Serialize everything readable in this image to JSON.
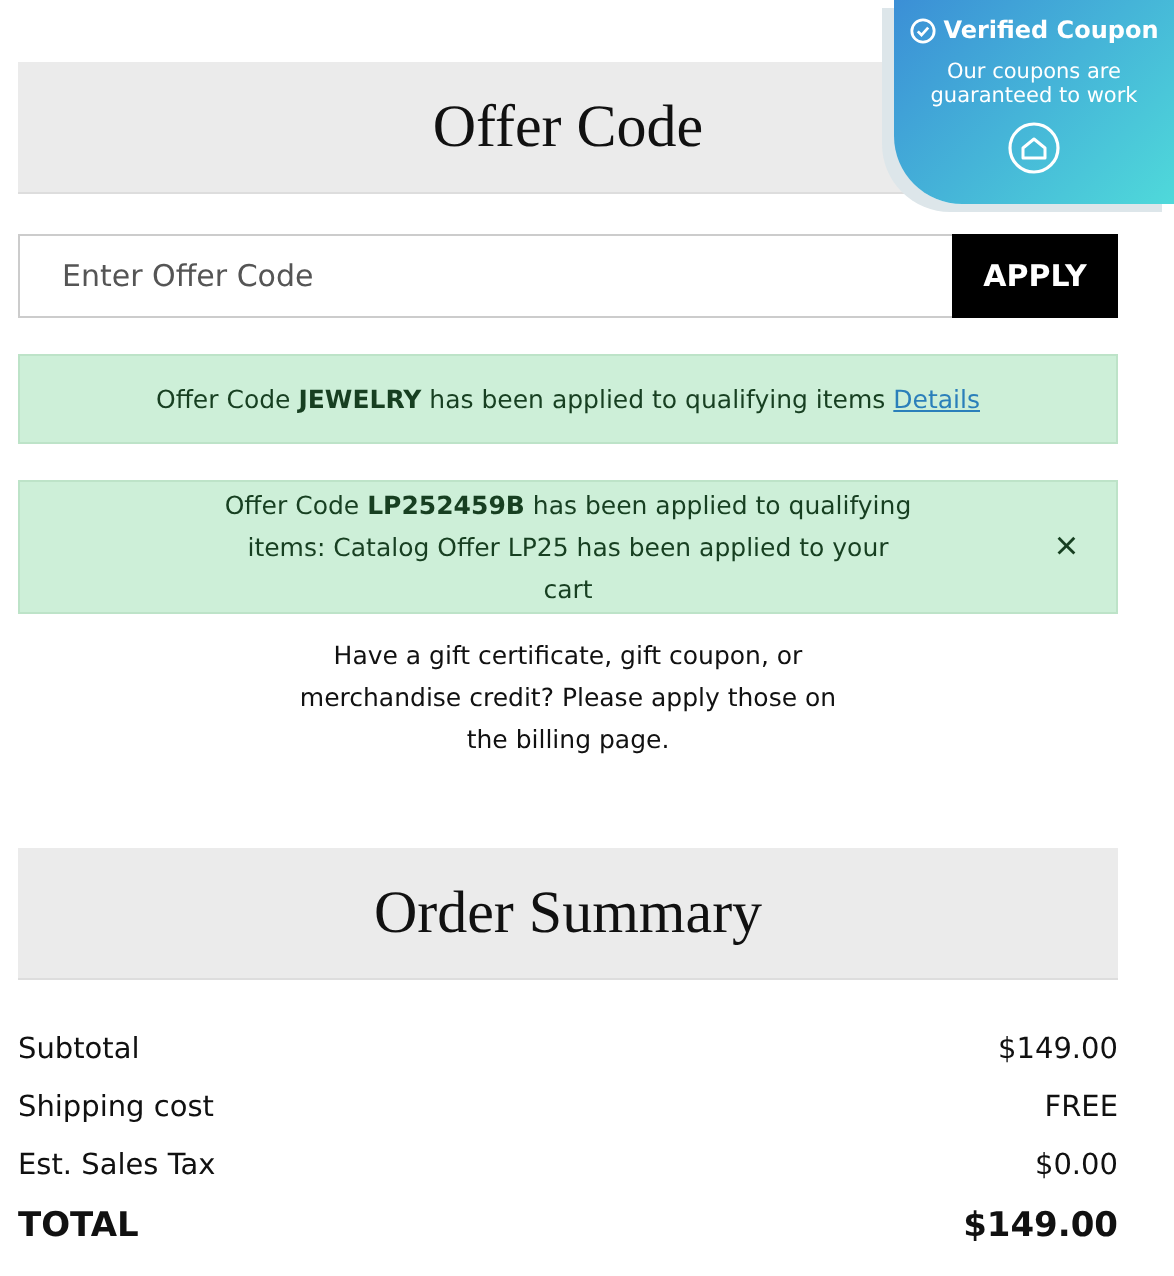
{
  "offer_code": {
    "title": "Offer Code",
    "input": {
      "placeholder": "Enter Offer Code"
    },
    "apply_button": "APPLY",
    "messages": [
      {
        "text": "Offer Code **JEWELRY** has been applied to qualifying items",
        "link": "Details",
        "dismissible": false
      },
      {
        "text": "Offer Code **LP252459B** has been applied to qualifying items: Catalog Offer LP25 has been applied to your cart",
        "dismissible": true,
        "close": "×"
      }
    ],
    "gift_note": "Have a gift certificate, gift coupon, or merchandise credit? Please apply those on the billing page."
  },
  "order_summary": {
    "title": "Order Summary",
    "rows": [
      {
        "label": "Subtotal",
        "value": "$149.00",
        "kind": "line"
      },
      {
        "label": "Shipping cost",
        "value": "FREE",
        "kind": "line"
      },
      {
        "label": "Est. Sales Tax",
        "value": "$0.00",
        "kind": "line"
      },
      {
        "label": "TOTAL",
        "value": "$149.00",
        "kind": "total"
      }
    ]
  },
  "verified_badge": {
    "title": "Verified Coupon",
    "subtitle": "Our coupons are guaranteed to work"
  }
}
